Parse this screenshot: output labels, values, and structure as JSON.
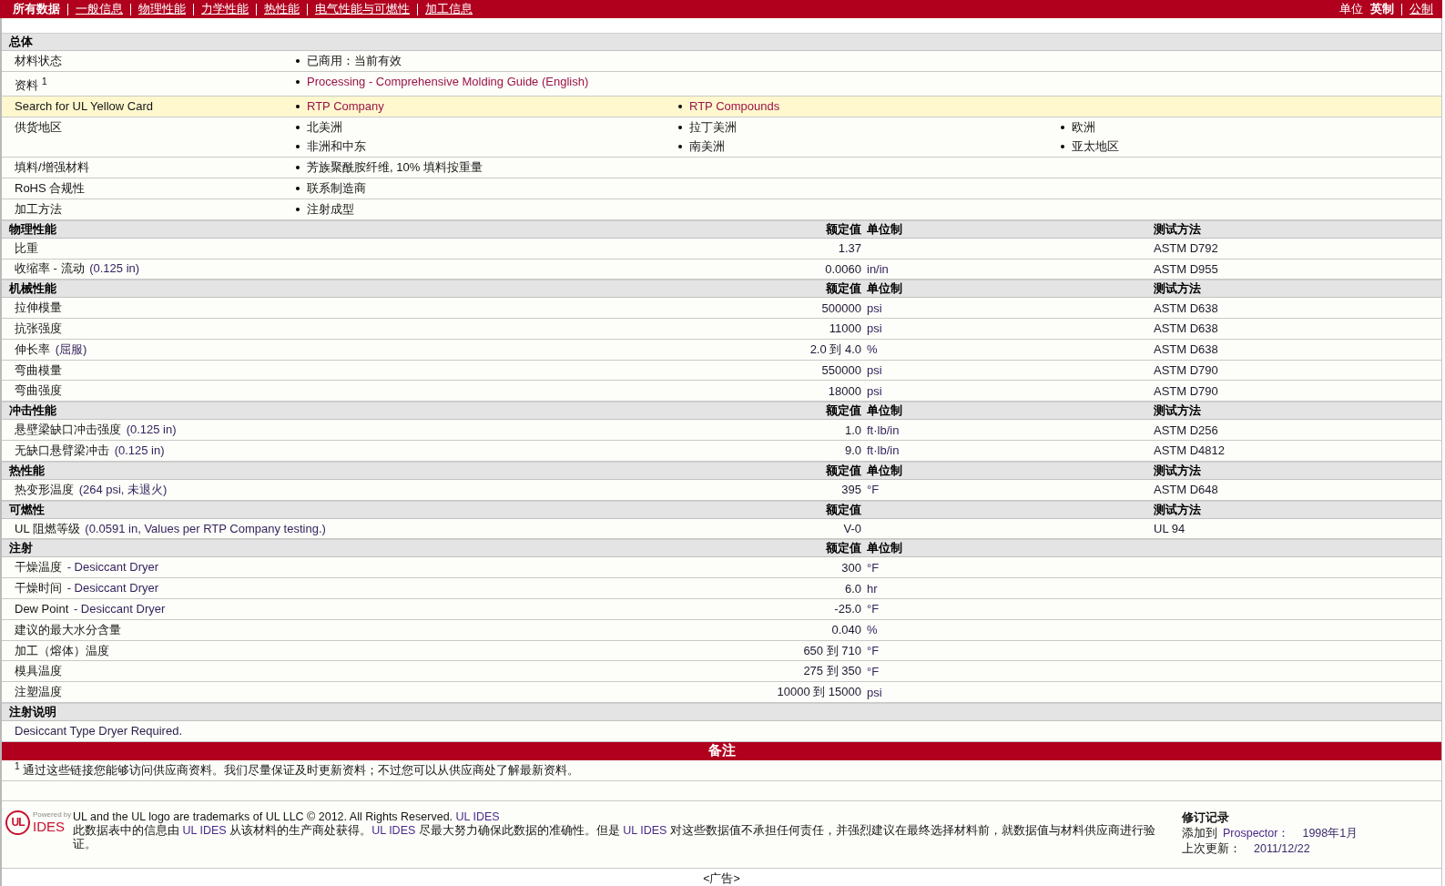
{
  "nav": {
    "tabs": [
      {
        "label": "所有数据",
        "selected": true
      },
      {
        "label": "一般信息",
        "selected": false
      },
      {
        "label": "物理性能",
        "selected": false
      },
      {
        "label": "力学性能",
        "selected": false
      },
      {
        "label": "热性能",
        "selected": false
      },
      {
        "label": "电气性能与可燃性",
        "selected": false
      },
      {
        "label": "加工信息",
        "selected": false
      }
    ],
    "units_label": "单位",
    "units": [
      {
        "label": "英制",
        "selected": true
      },
      {
        "label": "公制",
        "selected": false
      }
    ]
  },
  "general": {
    "title": "总体",
    "rows": [
      {
        "label": "材料状态",
        "highlighted": false,
        "items": [
          {
            "text": "已商用：当前有效",
            "link": false
          }
        ]
      },
      {
        "label": "资料 $^{1}$",
        "highlighted": false,
        "items": [
          {
            "text": "Processing - Comprehensive Molding Guide (English)",
            "link": true
          }
        ]
      },
      {
        "label": "Search for UL Yellow Card",
        "highlighted": true,
        "items": [
          {
            "text": "RTP Company",
            "link": true
          },
          {
            "text": "RTP Compounds",
            "link": true
          }
        ]
      },
      {
        "label": "供货地区",
        "highlighted": false,
        "items": [
          {
            "text": "北美洲",
            "link": false
          },
          {
            "text": "拉丁美洲",
            "link": false
          },
          {
            "text": "欧洲",
            "link": false
          },
          {
            "text": "非洲和中东",
            "link": false
          },
          {
            "text": "南美洲",
            "link": false
          },
          {
            "text": "亚太地区",
            "link": false
          }
        ]
      },
      {
        "label": "填料/增强材料",
        "highlighted": false,
        "items": [
          {
            "text": "芳族聚酰胺纤维, 10% 填料按重量",
            "link": false
          }
        ]
      },
      {
        "label": "RoHS 合规性",
        "highlighted": false,
        "items": [
          {
            "text": "联系制造商",
            "link": false
          }
        ]
      },
      {
        "label": "加工方法",
        "highlighted": false,
        "items": [
          {
            "text": "注射成型",
            "link": false
          }
        ]
      }
    ]
  },
  "sections": [
    {
      "title": "物理性能",
      "value_heading": "额定值",
      "unit_heading": "单位制",
      "method_heading": "测试方法",
      "rows": [
        {
          "name": "比重",
          "value": "1.37",
          "method": "ASTM D792"
        },
        {
          "name": "收缩率 - 流动",
          "condition": "(0.125 in)",
          "value": "0.0060",
          "unit": "in/in",
          "method": "ASTM D955"
        }
      ]
    },
    {
      "title": "机械性能",
      "value_heading": "额定值",
      "unit_heading": "单位制",
      "method_heading": "测试方法",
      "rows": [
        {
          "name": "拉伸模量",
          "value": "500000",
          "unit": "psi",
          "method": "ASTM D638"
        },
        {
          "name": "抗张强度",
          "value": "11000",
          "unit": "psi",
          "method": "ASTM D638"
        },
        {
          "name": "伸长率",
          "condition": "(屈服)",
          "value": "2.0 到 4.0",
          "unit": "%",
          "method": "ASTM D638"
        },
        {
          "name": "弯曲模量",
          "value": "550000",
          "unit": "psi",
          "method": "ASTM D790"
        },
        {
          "name": "弯曲强度",
          "value": "18000",
          "unit": "psi",
          "method": "ASTM D790"
        }
      ]
    },
    {
      "title": "冲击性能",
      "value_heading": "额定值",
      "unit_heading": "单位制",
      "method_heading": "测试方法",
      "rows": [
        {
          "name": "悬壁梁缺口冲击强度",
          "condition": "(0.125 in)",
          "value": "1.0",
          "unit": "ft·lb/in",
          "method": "ASTM D256"
        },
        {
          "name": "无缺口悬臂梁冲击",
          "condition": "(0.125 in)",
          "value": "9.0",
          "unit": "ft·lb/in",
          "method": "ASTM D4812"
        }
      ]
    },
    {
      "title": "热性能",
      "value_heading": "额定值",
      "unit_heading": "单位制",
      "method_heading": "测试方法",
      "rows": [
        {
          "name": "热变形温度",
          "condition": "(264 psi, 未退火)",
          "value": "395",
          "unit": "°F",
          "method": "ASTM D648"
        }
      ]
    },
    {
      "title": "可燃性",
      "value_heading": "额定值",
      "method_heading": "测试方法",
      "rows": [
        {
          "name": "UL 阻燃等级",
          "condition": "(0.0591 in, Values per RTP Company testing.)",
          "value": "V-0",
          "method": "UL 94"
        }
      ]
    },
    {
      "title": "注射",
      "value_heading": "额定值",
      "unit_heading": "单位制",
      "rows": [
        {
          "name": "干燥温度",
          "condition": "- Desiccant Dryer",
          "value": "300",
          "unit": "°F"
        },
        {
          "name": "干燥时间",
          "condition": "- Desiccant Dryer",
          "value": "6.0",
          "unit": "hr"
        },
        {
          "name": "Dew Point",
          "condition": "- Desiccant Dryer",
          "value": "-25.0",
          "unit": "°F"
        },
        {
          "name": "建议的最大水分含量",
          "value": "0.040",
          "unit": "%"
        },
        {
          "name": "加工（熔体）温度",
          "value": "650 到 710",
          "unit": "°F"
        },
        {
          "name": "模具温度",
          "value": "275 到 350",
          "unit": "°F"
        },
        {
          "name": "注塑温度",
          "value": "10000 到 15000",
          "unit": "psi"
        }
      ]
    }
  ],
  "notes_section": {
    "title": "注射说明",
    "text": "Desiccant Type Dryer Required."
  },
  "remarks": {
    "title": "备注",
    "footnote": "$^{1}$ 通过这些链接您能够访问供应商资料。我们尽量保证及时更新资料；不过您可以从供应商处了解最新资料。"
  },
  "footer": {
    "logo": {
      "mark": "UL",
      "powered_by": "Powered by",
      "name": "IDES"
    },
    "trademark": [
      {
        "text": "UL and the UL logo are trademarks of UL LLC © 2012. All Rights Reserved. ",
        "link": false
      },
      {
        "text": "UL IDES",
        "link": true
      }
    ],
    "disclaimer": [
      {
        "text": "此数据表中的信息由 ",
        "link": false
      },
      {
        "text": "UL IDES",
        "link": true
      },
      {
        "text": " 从该材料的生产商处获得。",
        "link": false
      },
      {
        "text": "UL IDES",
        "link": true
      },
      {
        "text": " 尽最大努力确保此数据的准确性。但是 ",
        "link": false
      },
      {
        "text": "UL IDES",
        "link": true
      },
      {
        "text": " 对这些数据值不承担任何责任，并强烈建议在最终选择材料前，就数据值与材料供应商进行验证。",
        "link": false
      }
    ],
    "revision": {
      "title": "修订记录",
      "entries": [
        {
          "label": "添加到",
          "link": "Prospector：",
          "value": "1998年1月"
        },
        {
          "label": "上次更新：",
          "value": "2011/12/22"
        }
      ]
    }
  },
  "ad": "<广告>"
}
